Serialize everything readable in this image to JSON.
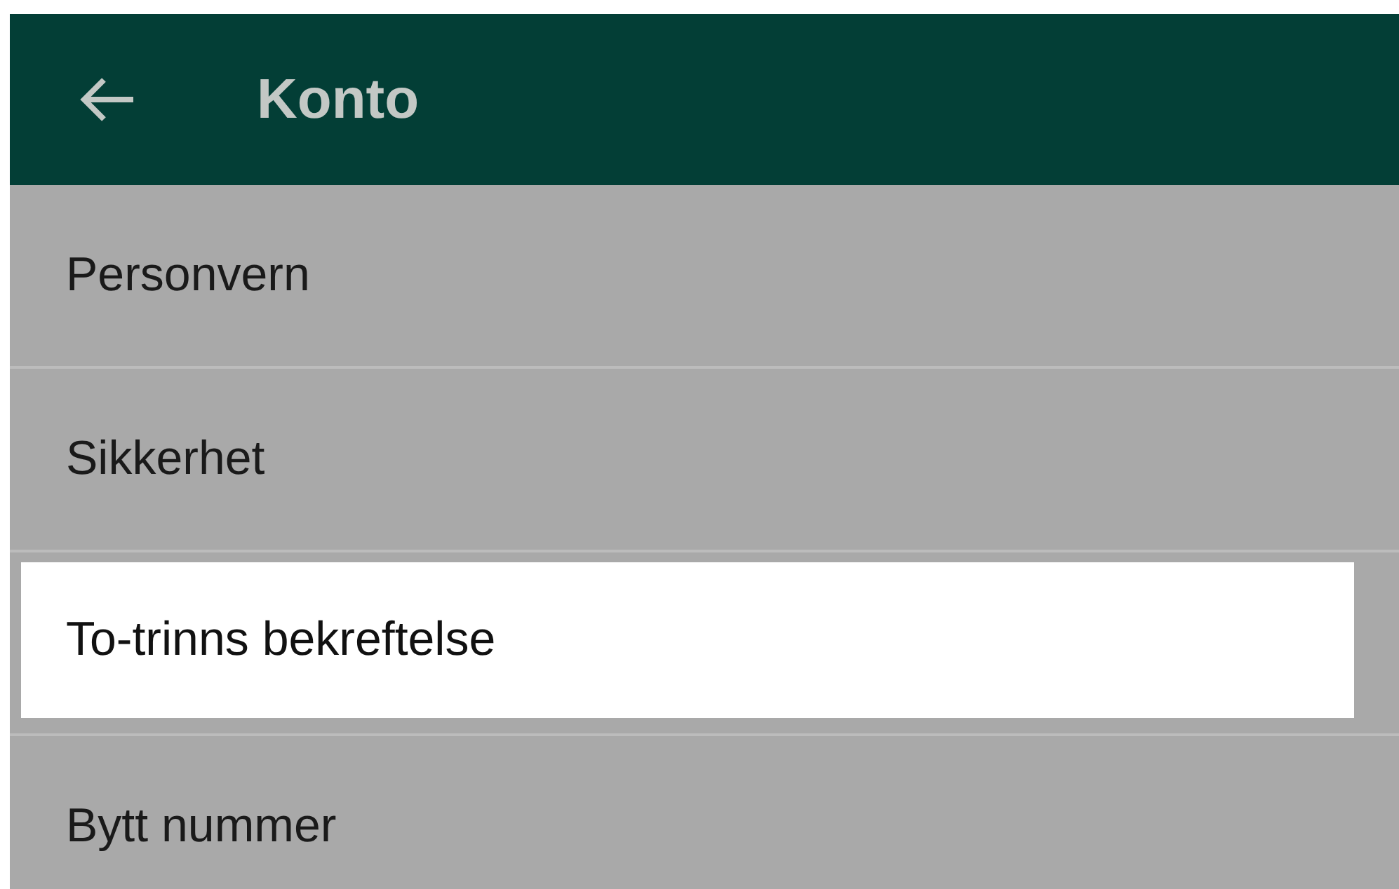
{
  "app_bar": {
    "title": "Konto"
  },
  "items": [
    {
      "label": "Personvern",
      "selected": false
    },
    {
      "label": "Sikkerhet",
      "selected": false
    },
    {
      "label": "To-trinns bekreftelse",
      "selected": true
    },
    {
      "label": "Bytt nummer",
      "selected": false
    }
  ]
}
